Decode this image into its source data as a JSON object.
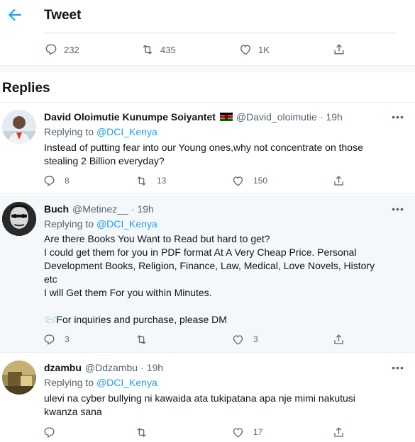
{
  "header": {
    "title": "Tweet"
  },
  "stats": {
    "replies": "232",
    "retweets": "435",
    "likes": "1K"
  },
  "replies_section": {
    "title": "Replies"
  },
  "replies": [
    {
      "name": "David Oloimutie Kunumpe Soiyantet",
      "handle": "@David_oloimutie",
      "dot": "·",
      "time": "19h",
      "replying_prefix": "Replying to",
      "mention": "@DCI_Kenya",
      "text_lines": [
        "Instead of putting fear into our Young ones,why not concentrate on those",
        "stealing 2 Billion everyday?"
      ],
      "counts": {
        "replies": "8",
        "retweets": "13",
        "likes": "150"
      }
    },
    {
      "name": "Buch",
      "handle": "@Metinez__",
      "dot": "·",
      "time": "19h",
      "replying_prefix": "Replying to",
      "mention": "@DCI_Kenya",
      "text_lines": [
        "Are there Books You Want to Read but hard to get?",
        "I could get them for you in PDF format At A Very Cheap Price. Personal",
        "Development Books, Religion, Finance, Law, Medical, Love Novels, History",
        "etc",
        "I will Get them For you within Minutes.",
        "",
        "📨For inquiries and purchase, please DM"
      ],
      "counts": {
        "replies": "3",
        "retweets": "",
        "likes": "3"
      }
    },
    {
      "name": "dzambu",
      "handle": "@Ddzambu",
      "dot": "·",
      "time": "19h",
      "replying_prefix": "Replying to",
      "mention": "@DCI_Kenya",
      "text_lines": [
        "ulevi na cyber bullying ni kawaida ata tukipatana apa nje mimi nakutusi",
        "kwanza sana"
      ],
      "counts": {
        "replies": "",
        "retweets": "",
        "likes": "17"
      }
    }
  ],
  "colors": {
    "accent": "#1da1f2",
    "muted": "#536471",
    "text": "#0f1419",
    "flag_black": "#000000",
    "flag_red": "#bb0000",
    "flag_green": "#006600"
  }
}
